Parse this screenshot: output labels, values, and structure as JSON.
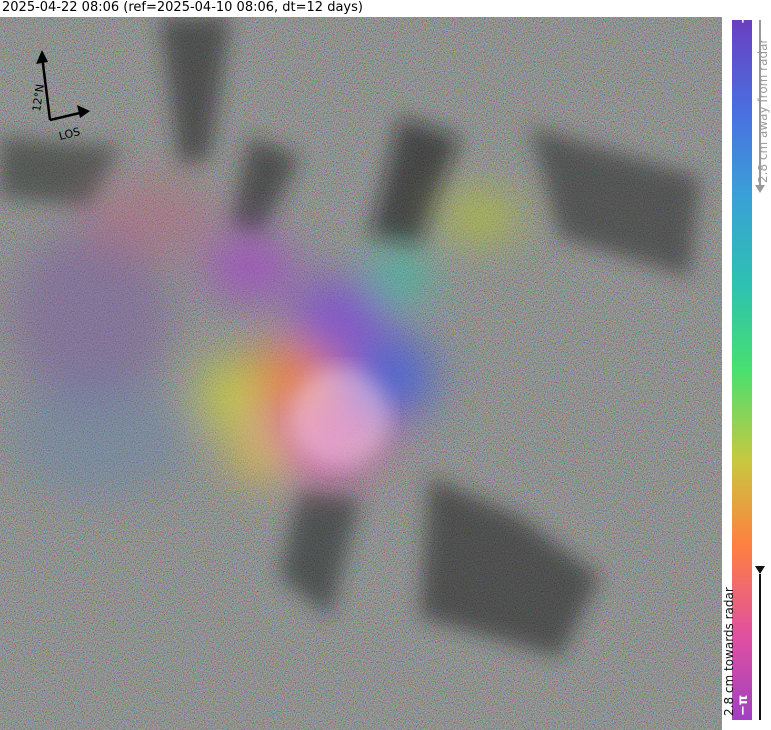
{
  "title": "2025-04-22 08:06 (ref=2025-04-10 08:06, dt=12 days)",
  "compass": {
    "north_label": "12°N",
    "los_label": "LOS",
    "icon": "north-arrow-icon"
  },
  "colorbar": {
    "top_label": "+π",
    "bottom_label": "−π",
    "away_label": "2.8 cm away from radar",
    "towards_label": "2.8 cm towards radar",
    "colors": [
      "#6a3fc0",
      "#4a6fe0",
      "#3aa0d8",
      "#2dc2b0",
      "#48e070",
      "#c8c840",
      "#ff8040",
      "#e050a0",
      "#a040c0"
    ]
  }
}
